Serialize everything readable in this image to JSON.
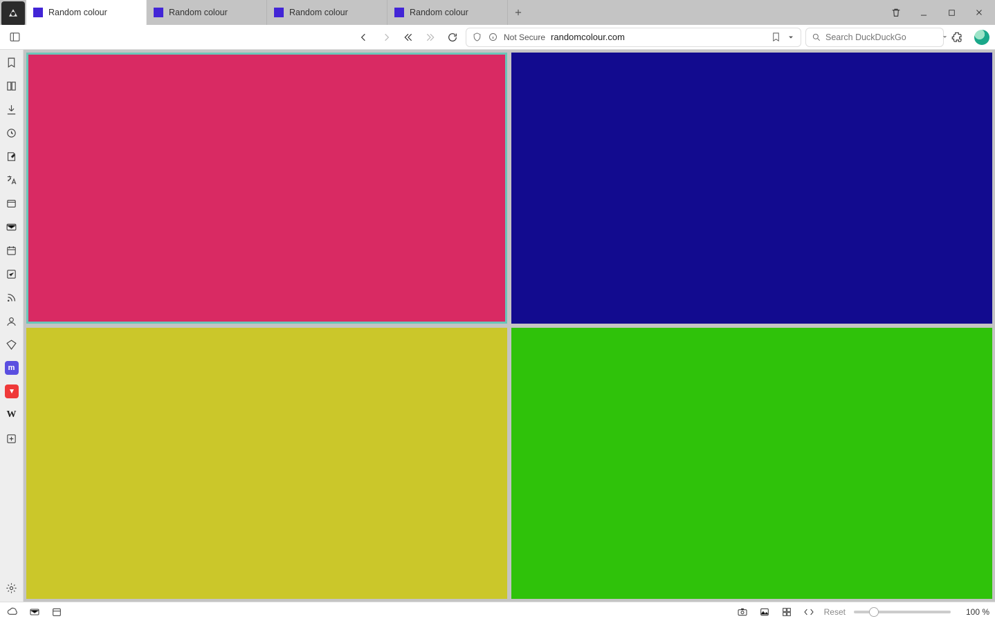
{
  "tabs": [
    {
      "title": "Random colour",
      "favicon_color": "#4225d6"
    },
    {
      "title": "Random colour",
      "favicon_color": "#4225d6"
    },
    {
      "title": "Random colour",
      "favicon_color": "#4225d6"
    },
    {
      "title": "Random colour",
      "favicon_color": "#4225d6"
    }
  ],
  "addressbar": {
    "security_label": "Not Secure",
    "url": "randomcolour.com"
  },
  "search": {
    "placeholder": "Search DuckDuckGo"
  },
  "tiles": {
    "top_left": "#d92a63",
    "top_right": "#120b8f",
    "bottom_left": "#cbc72a",
    "bottom_right": "#2fc20a"
  },
  "statusbar": {
    "reset_label": "Reset",
    "zoom_label": "100 %",
    "zoom_percent": 100
  },
  "panel_icons": [
    "panels-icon",
    "bookmarks-icon",
    "reading-list-icon",
    "downloads-icon",
    "history-icon",
    "notes-icon",
    "translate-icon",
    "window-icon",
    "mail-icon",
    "calendar-icon",
    "tasks-icon",
    "feeds-icon",
    "contacts-icon",
    "sessions-icon",
    "mastodon-icon",
    "vivaldi-icon",
    "wikipedia-icon",
    "add-panel-icon"
  ]
}
